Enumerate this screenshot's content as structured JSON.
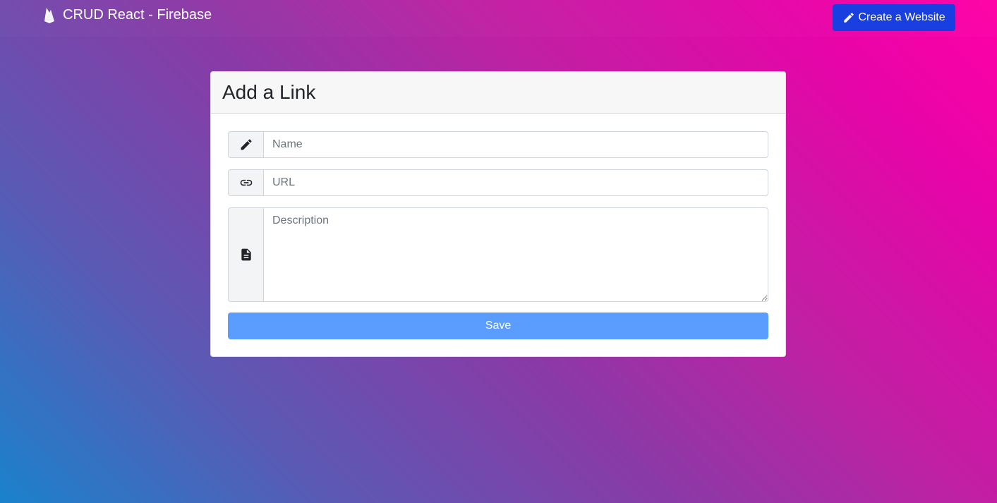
{
  "navbar": {
    "brand_icon": "firebase-icon",
    "brand_label": "CRUD React - Firebase",
    "create_button_icon": "pencil-icon",
    "create_button_label": "Create a Website"
  },
  "form": {
    "title": "Add a Link",
    "name_icon": "pencil-icon",
    "name_placeholder": "Name",
    "name_value": "",
    "url_icon": "link-icon",
    "url_placeholder": "URL",
    "url_value": "",
    "description_icon": "document-icon",
    "description_placeholder": "Description",
    "description_value": "",
    "save_label": "Save"
  },
  "colors": {
    "primary_button": "#1a3fe0",
    "save_button": "#5b9cff",
    "gradient_start": "#1a82cc",
    "gradient_end": "#ff00a6"
  }
}
